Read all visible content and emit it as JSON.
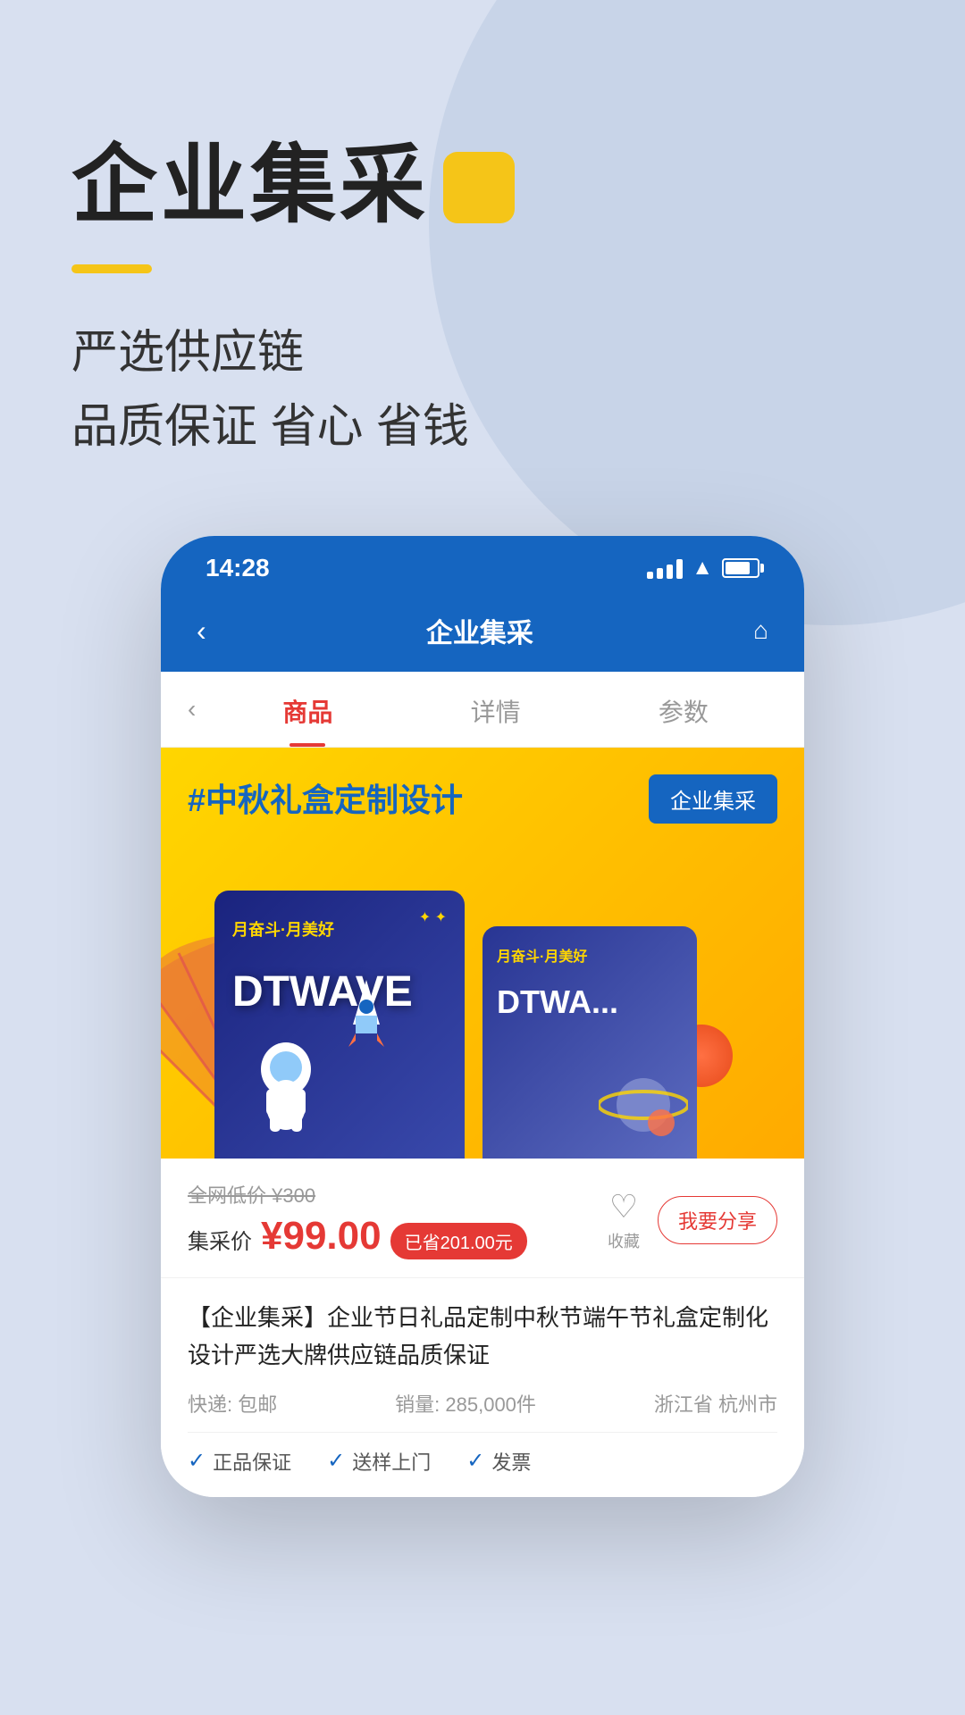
{
  "hero": {
    "title": "企业集采",
    "subtitle_line1": "严选供应链",
    "subtitle_line2": "品质保证 省心 省钱"
  },
  "phone": {
    "status_time": "14:28",
    "nav_title": "企业集采",
    "tabs": [
      {
        "label": "商品",
        "active": true
      },
      {
        "label": "详情",
        "active": false
      },
      {
        "label": "参数",
        "active": false
      }
    ],
    "enterprise_badge": "企业集采",
    "product_title_tag": "#中秋礼盒定制设计",
    "product_box_text": "DTWAVE",
    "product_box_sub": "月奋斗·月美好",
    "original_price": "全网低价 ¥300",
    "group_price_label": "集采价",
    "group_price": "¥99.00",
    "saved_badge": "已省201.00元",
    "favorite_label": "收藏",
    "share_label": "我要分享",
    "product_name": "【企业集采】企业节日礼品定制中秋节端午节礼盒定制化设计严选大牌供应链品质保证",
    "shipping": "快递: 包邮",
    "sales": "销量: 285,000件",
    "location": "浙江省 杭州市",
    "guarantees": [
      {
        "icon": "✓",
        "label": "正品保证"
      },
      {
        "icon": "✓",
        "label": "送样上门"
      },
      {
        "icon": "✓",
        "label": "发票"
      }
    ]
  }
}
